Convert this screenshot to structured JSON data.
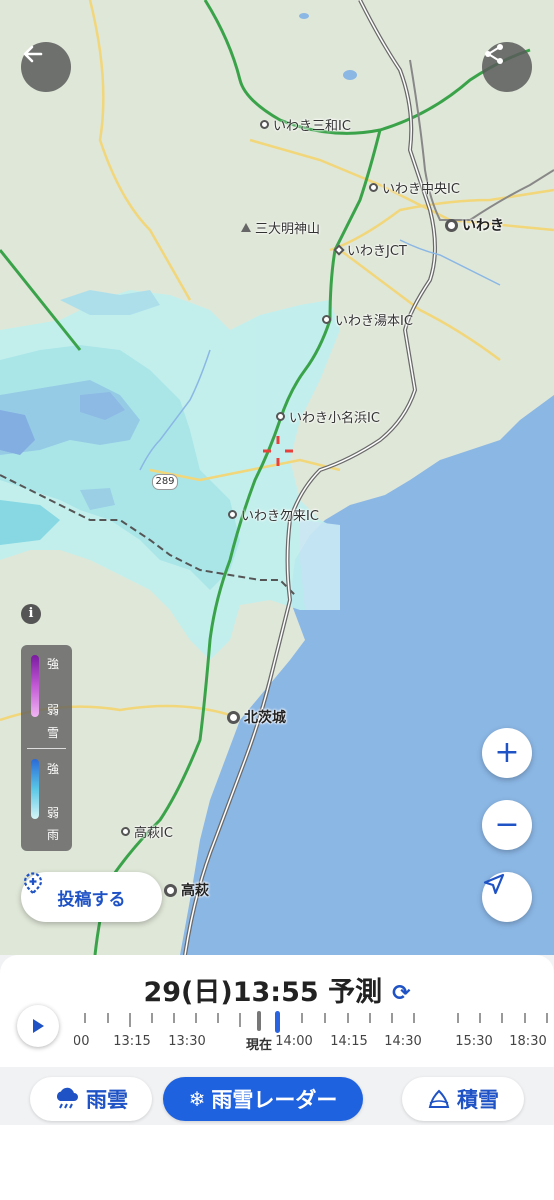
{
  "map": {
    "places": {
      "iwaki_miwa_ic": "いわき三和IC",
      "iwaki_chuo_ic": "いわき中央IC",
      "iwaki": "いわき",
      "sandaimyojin": "三大明神山",
      "iwaki_jct": "いわきJCT",
      "iwaki_yumoto_ic": "いわき湯本IC",
      "iwaki_onahama_ic": "いわき小名浜IC",
      "iwaki_nakoso_ic": "いわき勿来IC",
      "kitaibaraki": "北茨城",
      "takahagi_ic": "高萩IC",
      "takahagi": "高萩"
    },
    "route_number": "289",
    "colors": {
      "land": "#dfe7d8",
      "sea": "#8bb7e5",
      "rain_light": "#bff0ef",
      "rain_mid": "#7ed7e4",
      "rain_strong": "#79a8e2",
      "expressway": "#5b5b5b",
      "national_road": "#3aa34a"
    }
  },
  "controls": {
    "back_icon": "arrow-left-icon",
    "share_icon": "share-icon",
    "zoom_in": "+",
    "zoom_out": "−",
    "locate_icon": "location-arrow-icon",
    "info": "i",
    "post_label": "投稿する"
  },
  "legend": {
    "snow": {
      "strong": "強",
      "weak": "弱",
      "label": "雪"
    },
    "rain": {
      "strong": "強",
      "weak": "弱",
      "label": "雨"
    }
  },
  "time_panel": {
    "date": "29(日)",
    "time": "13:55",
    "mode": "予測",
    "timeline_labels": [
      ":00",
      "13:15",
      "13:30",
      "現在",
      "14:00",
      "14:15",
      "14:30",
      "15:30",
      "18:30"
    ]
  },
  "tabs": [
    {
      "label": "雨雲",
      "icon": "rain-cloud-icon",
      "active": false
    },
    {
      "label": "雨雪レーダー",
      "icon": "snow-rain-icon",
      "active": true
    },
    {
      "label": "積雪",
      "icon": "snow-pile-icon",
      "active": false
    }
  ]
}
